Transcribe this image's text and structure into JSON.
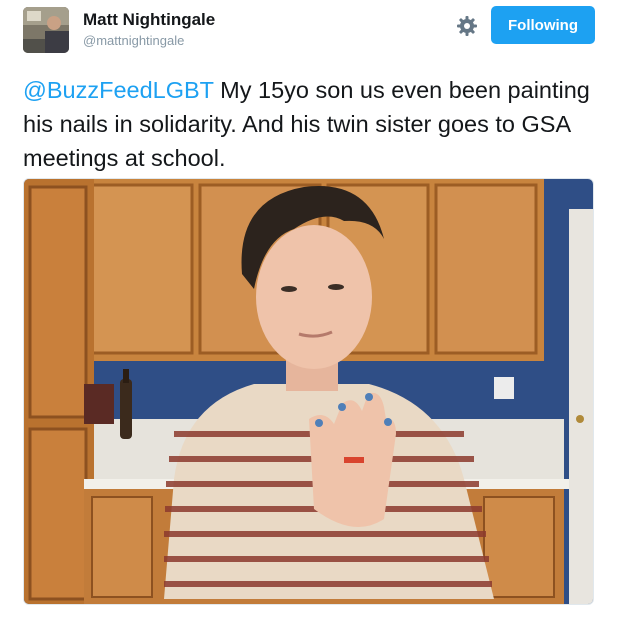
{
  "user": {
    "display_name": "Matt Nightingale",
    "handle": "@mattnightingale",
    "avatar_icon": "user-avatar"
  },
  "actions": {
    "settings_icon": "gear-icon",
    "follow_label": "Following"
  },
  "tweet": {
    "mention": "@BuzzFeedLGBT",
    "body": " My 15yo son us even been painting his nails in solidarity. And his twin sister goes to GSA meetings at school."
  },
  "photo": {
    "icon": "tweet-photo"
  },
  "colors": {
    "accent": "#1da1f2",
    "text": "#14171a",
    "muted": "#8899a6"
  }
}
